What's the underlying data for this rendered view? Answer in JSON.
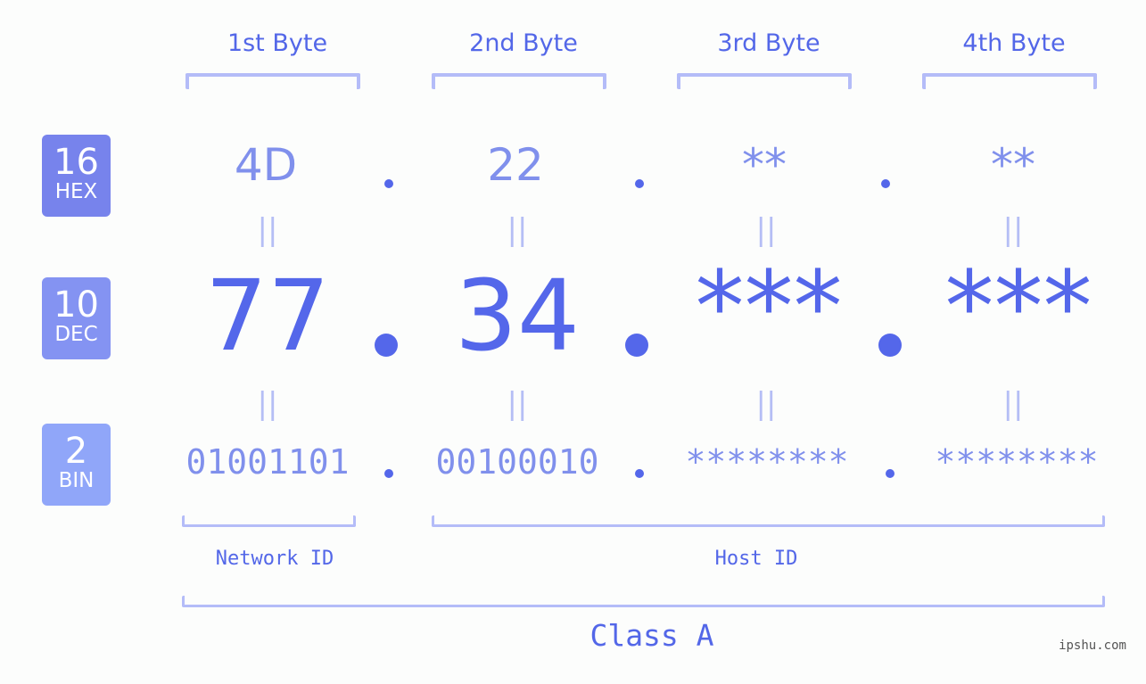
{
  "bytes": [
    {
      "header": "1st Byte",
      "hex": "4D",
      "dec": "77",
      "bin": "01001101"
    },
    {
      "header": "2nd Byte",
      "hex": "22",
      "dec": "34",
      "bin": "00100010"
    },
    {
      "header": "3rd Byte",
      "hex": "**",
      "dec": "***",
      "bin": "********"
    },
    {
      "header": "4th Byte",
      "hex": "**",
      "dec": "***",
      "bin": "********"
    }
  ],
  "badges": {
    "hex": {
      "base": "16",
      "label": "HEX"
    },
    "dec": {
      "base": "10",
      "label": "DEC"
    },
    "bin": {
      "base": "2",
      "label": "BIN"
    }
  },
  "equals": "||",
  "sections": {
    "network": "Network ID",
    "host": "Host ID",
    "class": "Class A"
  },
  "watermark": "ipshu.com",
  "colors": {
    "accent": "#5467ea",
    "light": "#8090ec",
    "bracket": "#b4bcf8"
  }
}
